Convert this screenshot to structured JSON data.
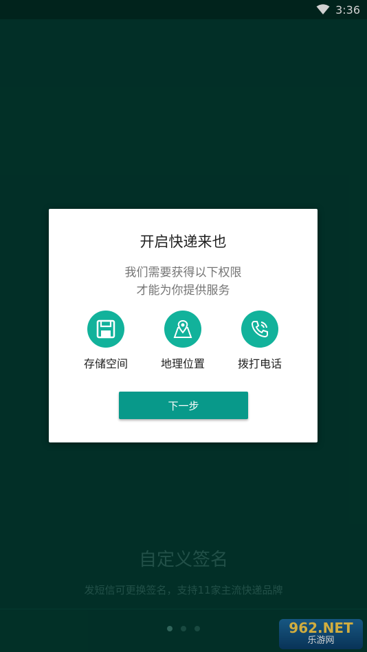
{
  "status_bar": {
    "time": "3:36",
    "wifi_icon": "wifi-icon"
  },
  "background": {
    "feature_title": "自定义签名",
    "feature_desc": "发短信可更换签名，支持11家主流快递品牌",
    "pager": {
      "count": 3,
      "active": 0
    }
  },
  "dialog": {
    "title": "开启快递来也",
    "subtitle_line1": "我们需要获得以下权限",
    "subtitle_line2": "才能为你提供服务",
    "permissions": [
      {
        "label": "存储空间",
        "icon": "floppy-disk-icon"
      },
      {
        "label": "地理位置",
        "icon": "map-pin-icon"
      },
      {
        "label": "拨打电话",
        "icon": "phone-icon"
      }
    ],
    "next_button": "下一步"
  },
  "watermark": {
    "top": "962.NET",
    "bottom": "乐游网"
  },
  "colors": {
    "accent": "#12b29b",
    "button": "#08998a",
    "background": "#033a30"
  }
}
